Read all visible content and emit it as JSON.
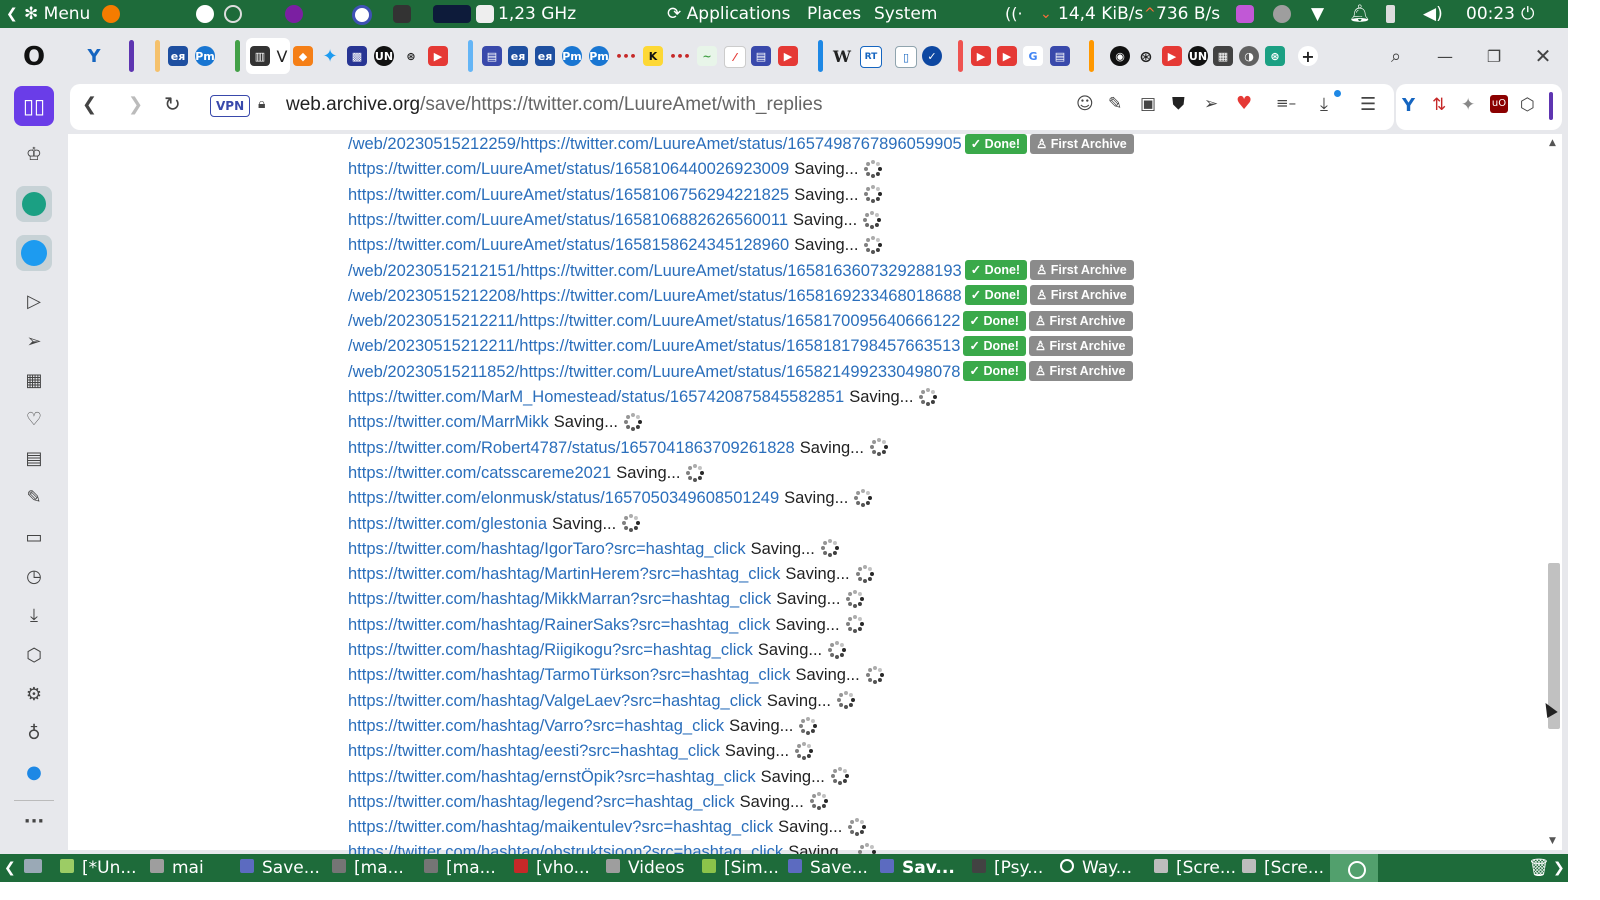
{
  "system_panel": {
    "menu_label": "Menu",
    "cpu_freq": "1,23 GHz",
    "applications_label": "Applications",
    "places_label": "Places",
    "system_label": "System",
    "net_down": "14,4 KiB/s",
    "net_up": "736 B/s",
    "clock": "00:23"
  },
  "address_bar": {
    "vpn_label": "VPN",
    "url_host": "web.archive.org",
    "url_path": "/save/https://twitter.com/LuureAmet/with_replies"
  },
  "labels": {
    "saving": "Saving...",
    "done": "Done!",
    "first_archive": "First Archive"
  },
  "rows": [
    {
      "url": "/web/20230515212259/https://twitter.com/LuureAmet/status/1657498767896059905",
      "status": "done"
    },
    {
      "url": "https://twitter.com/LuureAmet/status/1658106440026923009",
      "status": "saving"
    },
    {
      "url": "https://twitter.com/LuureAmet/status/1658106756294221825",
      "status": "saving"
    },
    {
      "url": "https://twitter.com/LuureAmet/status/1658106882626560011",
      "status": "saving"
    },
    {
      "url": "https://twitter.com/LuureAmet/status/1658158624345128960",
      "status": "saving"
    },
    {
      "url": "/web/20230515212151/https://twitter.com/LuureAmet/status/1658163607329288193",
      "status": "done"
    },
    {
      "url": "/web/20230515212208/https://twitter.com/LuureAmet/status/1658169233468018688",
      "status": "done"
    },
    {
      "url": "/web/20230515212211/https://twitter.com/LuureAmet/status/1658170095640666122",
      "status": "done"
    },
    {
      "url": "/web/20230515212211/https://twitter.com/LuureAmet/status/1658181798457663513",
      "status": "done"
    },
    {
      "url": "/web/20230515211852/https://twitter.com/LuureAmet/status/1658214992330498078",
      "status": "done"
    },
    {
      "url": "https://twitter.com/MarM_Homestead/status/1657420875845582851",
      "status": "saving"
    },
    {
      "url": "https://twitter.com/MarrMikk",
      "status": "saving"
    },
    {
      "url": "https://twitter.com/Robert4787/status/1657041863709261828",
      "status": "saving"
    },
    {
      "url": "https://twitter.com/catsscareme2021",
      "status": "saving"
    },
    {
      "url": "https://twitter.com/elonmusk/status/1657050349608501249",
      "status": "saving"
    },
    {
      "url": "https://twitter.com/glestonia",
      "status": "saving"
    },
    {
      "url": "https://twitter.com/hashtag/IgorTaro?src=hashtag_click",
      "status": "saving"
    },
    {
      "url": "https://twitter.com/hashtag/MartinHerem?src=hashtag_click",
      "status": "saving"
    },
    {
      "url": "https://twitter.com/hashtag/MikkMarran?src=hashtag_click",
      "status": "saving"
    },
    {
      "url": "https://twitter.com/hashtag/RainerSaks?src=hashtag_click",
      "status": "saving"
    },
    {
      "url": "https://twitter.com/hashtag/Riigikogu?src=hashtag_click",
      "status": "saving"
    },
    {
      "url": "https://twitter.com/hashtag/TarmoTürkson?src=hashtag_click",
      "status": "saving"
    },
    {
      "url": "https://twitter.com/hashtag/ValgeLaev?src=hashtag_click",
      "status": "saving"
    },
    {
      "url": "https://twitter.com/hashtag/Varro?src=hashtag_click",
      "status": "saving"
    },
    {
      "url": "https://twitter.com/hashtag/eesti?src=hashtag_click",
      "status": "saving"
    },
    {
      "url": "https://twitter.com/hashtag/ernstÖpik?src=hashtag_click",
      "status": "saving"
    },
    {
      "url": "https://twitter.com/hashtag/legend?src=hashtag_click",
      "status": "saving"
    },
    {
      "url": "https://twitter.com/hashtag/maikentulev?src=hashtag_click",
      "status": "saving"
    },
    {
      "url": "https://twitter.com/hashtag/obstruktsioon?src=hashtag_click",
      "status": "saving"
    }
  ],
  "taskbar": {
    "items": [
      {
        "label": "[*Un...",
        "icon": "text-editor-icon",
        "color": "#9ccc65"
      },
      {
        "label": "mai",
        "icon": "folder-icon",
        "color": "#9e9e9e"
      },
      {
        "label": "Save...",
        "icon": "archive-icon",
        "color": "#5c6bc0"
      },
      {
        "label": "[ma...",
        "icon": "terminal-icon",
        "color": "#757575"
      },
      {
        "label": "[ma...",
        "icon": "terminal-icon",
        "color": "#757575"
      },
      {
        "label": "[vho...",
        "icon": "filezilla-icon",
        "color": "#c62828"
      },
      {
        "label": "Videos",
        "icon": "folder-icon",
        "color": "#9e9e9e"
      },
      {
        "label": "[Sim...",
        "icon": "app-icon",
        "color": "#8bc34a"
      },
      {
        "label": "Save...",
        "icon": "archive-icon",
        "color": "#5c6bc0"
      },
      {
        "label": "Sav...",
        "icon": "archive-icon",
        "color": "#5c6bc0"
      },
      {
        "label": "[Psy...",
        "icon": "app-icon",
        "color": "#424242"
      },
      {
        "label": "Way...",
        "icon": "opera-icon",
        "color": "#ffffff"
      },
      {
        "label": "[Scre...",
        "icon": "screenshot-icon",
        "color": "#bdbdbd"
      },
      {
        "label": "[Scre...",
        "icon": "screenshot-icon",
        "color": "#bdbdbd"
      }
    ]
  }
}
